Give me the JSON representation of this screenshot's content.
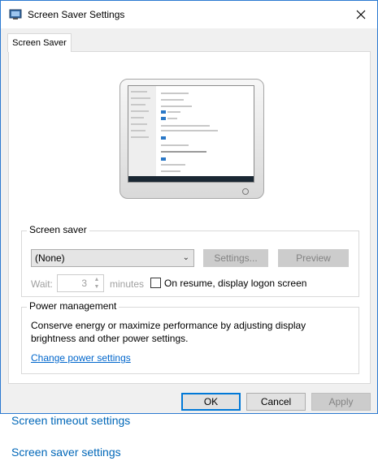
{
  "window": {
    "title": "Screen Saver Settings",
    "tab": "Screen Saver"
  },
  "screen_saver": {
    "group_label": "Screen saver",
    "selected": "(None)",
    "settings_label": "Settings...",
    "preview_label": "Preview",
    "wait_label": "Wait:",
    "wait_value": "3",
    "minutes_label": "minutes",
    "resume_label": "On resume, display logon screen",
    "resume_checked": false
  },
  "power": {
    "group_label": "Power management",
    "description": "Conserve energy or maximize performance by adjusting display brightness and other power settings.",
    "link": "Change power settings"
  },
  "buttons": {
    "ok": "OK",
    "cancel": "Cancel",
    "apply": "Apply"
  },
  "background_links": {
    "timeout": "Screen timeout settings",
    "saver": "Screen saver settings"
  },
  "colors": {
    "accent": "#0078d7",
    "link": "#0066cc",
    "window_border": "#2b79d1"
  }
}
